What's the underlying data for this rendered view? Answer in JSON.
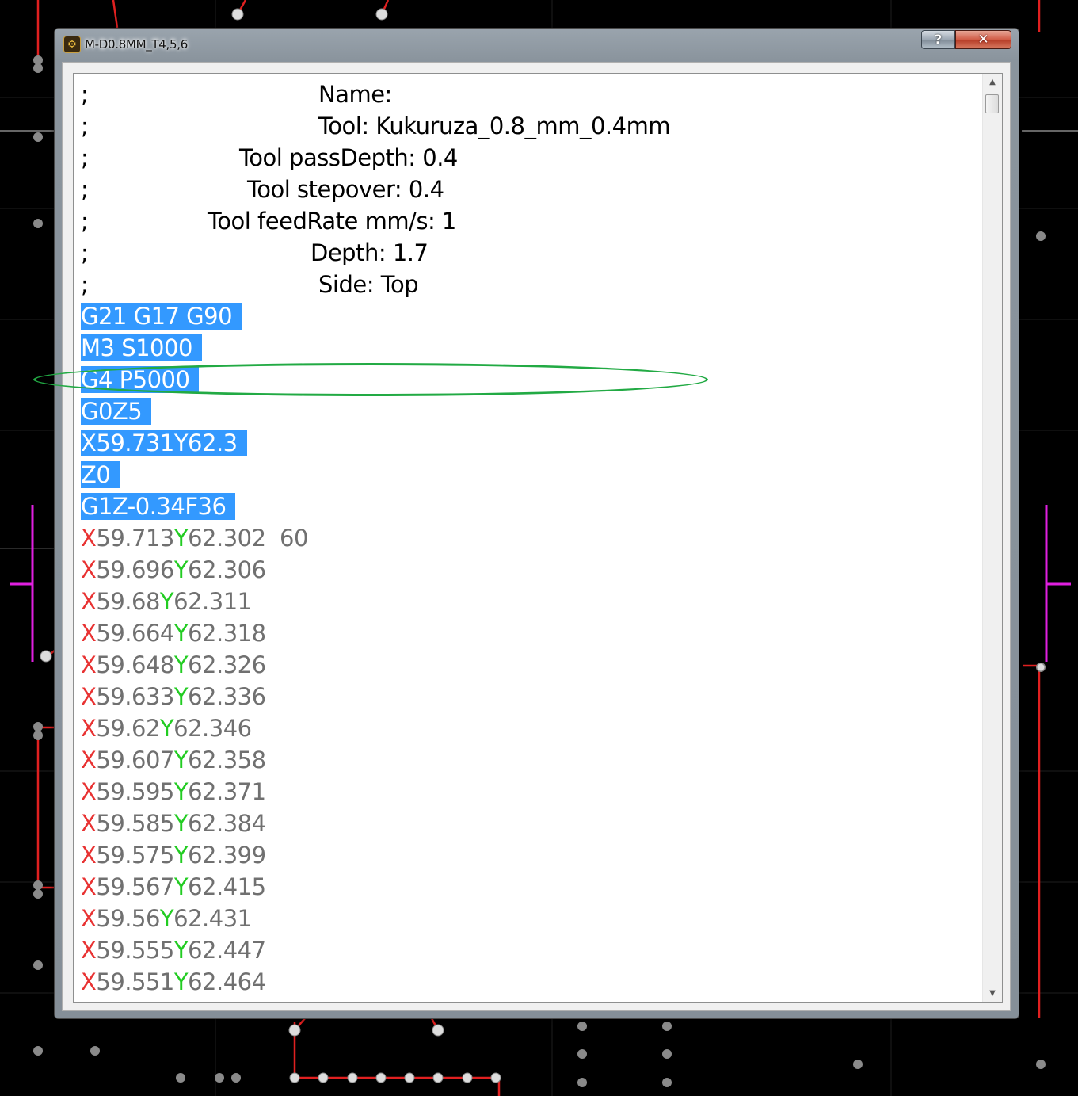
{
  "window": {
    "title": "M-D0.8MM_T4,5,6",
    "icon": "gear-app-icon",
    "help_label": "?",
    "close_label": "✕"
  },
  "comments": [
    {
      "prefix": ";",
      "text": "Name:"
    },
    {
      "prefix": ";",
      "text": "Tool: Kukuruza_0.8_mm_0.4mm"
    },
    {
      "prefix": ";",
      "text": "Tool passDepth: 0.4"
    },
    {
      "prefix": ";",
      "text": "Tool stepover: 0.4"
    },
    {
      "prefix": ";",
      "text": "Tool feedRate mm/s: 1"
    },
    {
      "prefix": ";",
      "text": "Depth: 1.7"
    },
    {
      "prefix": ";",
      "text": "Side: Top"
    }
  ],
  "selected_lines": [
    "G21 G17 G90",
    "M3 S1000",
    "G4 P5000",
    "G0Z5",
    "X59.731Y62.3",
    "Z0",
    "G1Z-0.34F36"
  ],
  "coord_lines": [
    {
      "x": "59.713",
      "y": "62.302",
      "extra": "  60"
    },
    {
      "x": "59.696",
      "y": "62.306",
      "extra": ""
    },
    {
      "x": "59.68",
      "y": "62.311",
      "extra": ""
    },
    {
      "x": "59.664",
      "y": "62.318",
      "extra": ""
    },
    {
      "x": "59.648",
      "y": "62.326",
      "extra": ""
    },
    {
      "x": "59.633",
      "y": "62.336",
      "extra": ""
    },
    {
      "x": "59.62",
      "y": "62.346",
      "extra": ""
    },
    {
      "x": "59.607",
      "y": "62.358",
      "extra": ""
    },
    {
      "x": "59.595",
      "y": "62.371",
      "extra": ""
    },
    {
      "x": "59.585",
      "y": "62.384",
      "extra": ""
    },
    {
      "x": "59.575",
      "y": "62.399",
      "extra": ""
    },
    {
      "x": "59.567",
      "y": "62.415",
      "extra": ""
    },
    {
      "x": "59.56",
      "y": "62.431",
      "extra": ""
    },
    {
      "x": "59.555",
      "y": "62.447",
      "extra": ""
    },
    {
      "x": "59.551",
      "y": "62.464",
      "extra": ""
    }
  ],
  "syntax": {
    "x_letter": "X",
    "y_letter": "Y"
  },
  "colors": {
    "selection": "#3399ff",
    "x_letter": "#e83232",
    "y_letter": "#22cc22",
    "number": "#707070",
    "annotation": "#22aa44",
    "pcb_trace": "#e02020",
    "pcb_marker": "#e020e0"
  },
  "annotation": {
    "highlighted_line": "G4 P5000"
  }
}
